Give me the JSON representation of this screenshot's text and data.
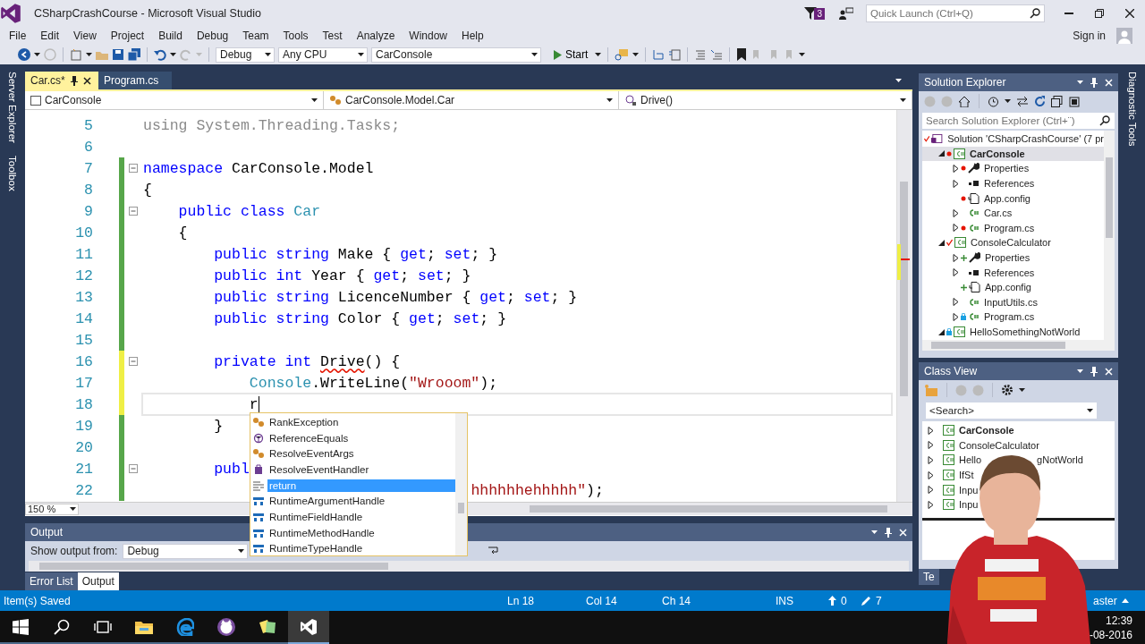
{
  "window": {
    "title": "CSharpCrashCourse - Microsoft Visual Studio",
    "notifications_badge": "3",
    "quick_launch": {
      "placeholder": "Quick Launch (Ctrl+Q)"
    }
  },
  "menu": [
    "File",
    "Edit",
    "View",
    "Project",
    "Build",
    "Debug",
    "Team",
    "Tools",
    "Test",
    "Analyze",
    "Window",
    "Help"
  ],
  "account": {
    "sign_in": "Sign in"
  },
  "toolbar": {
    "configuration": "Debug",
    "platform": "Any CPU",
    "startup_project": "CarConsole",
    "start": "Start"
  },
  "left_strip": [
    "Server Explorer",
    "Toolbox"
  ],
  "right_strip": [
    "Diagnostic Tools"
  ],
  "editor": {
    "tabs": [
      {
        "label": "Car.cs*",
        "selected": true
      },
      {
        "label": "Program.cs",
        "selected": false
      }
    ],
    "nav": [
      "CarConsole",
      "CarConsole.Model.Car",
      "Drive()"
    ],
    "zoom": "150 %",
    "lines": [
      {
        "number": "5",
        "fold": false,
        "current": false,
        "tokens": [
          {
            "kind": "faded",
            "text": "using System.Threading.Tasks;"
          }
        ]
      },
      {
        "number": "6",
        "fold": false,
        "current": false
      },
      {
        "number": "7",
        "color": "#57a64a",
        "fold": true,
        "current": false,
        "tokens": [
          {
            "kind": "kw",
            "text": "namespace"
          },
          {
            "kind": "plain",
            "text": " CarConsole.Model"
          }
        ]
      },
      {
        "number": "8",
        "color": "#57a64a",
        "fold": false,
        "current": false,
        "tokens": [
          {
            "kind": "plain",
            "text": "{"
          }
        ]
      },
      {
        "number": "9",
        "color": "#57a64a",
        "fold": true,
        "current": false,
        "tokens": [
          {
            "kind": "kw",
            "text": "    public"
          },
          {
            "kind": "kw",
            "text": " class"
          },
          {
            "kind": "type",
            "text": " Car"
          }
        ]
      },
      {
        "number": "10",
        "color": "#57a64a",
        "fold": false,
        "current": false,
        "tokens": [
          {
            "kind": "plain",
            "text": "    {"
          }
        ]
      },
      {
        "number": "11",
        "color": "#57a64a",
        "fold": false,
        "current": false,
        "tokens": [
          {
            "kind": "kw",
            "text": "        public"
          },
          {
            "kind": "kw",
            "text": " string"
          },
          {
            "kind": "plain",
            "text": " Make { "
          },
          {
            "kind": "kw",
            "text": "get"
          },
          {
            "kind": "plain",
            "text": "; "
          },
          {
            "kind": "kw",
            "text": "set"
          },
          {
            "kind": "plain",
            "text": "; }"
          }
        ]
      },
      {
        "number": "12",
        "color": "#57a64a",
        "fold": false,
        "current": false,
        "tokens": [
          {
            "kind": "kw",
            "text": "        public"
          },
          {
            "kind": "kw",
            "text": " int"
          },
          {
            "kind": "plain",
            "text": " Year { "
          },
          {
            "kind": "kw",
            "text": "get"
          },
          {
            "kind": "plain",
            "text": "; "
          },
          {
            "kind": "kw",
            "text": "set"
          },
          {
            "kind": "plain",
            "text": "; }"
          }
        ]
      },
      {
        "number": "13",
        "color": "#57a64a",
        "fold": false,
        "current": false,
        "tokens": [
          {
            "kind": "kw",
            "text": "        public"
          },
          {
            "kind": "kw",
            "text": " string"
          },
          {
            "kind": "plain",
            "text": " LicenceNumber { "
          },
          {
            "kind": "kw",
            "text": "get"
          },
          {
            "kind": "plain",
            "text": "; "
          },
          {
            "kind": "kw",
            "text": "set"
          },
          {
            "kind": "plain",
            "text": "; }"
          }
        ]
      },
      {
        "number": "14",
        "color": "#57a64a",
        "fold": false,
        "current": false,
        "tokens": [
          {
            "kind": "kw",
            "text": "        public"
          },
          {
            "kind": "kw",
            "text": " string"
          },
          {
            "kind": "plain",
            "text": " Color { "
          },
          {
            "kind": "kw",
            "text": "get"
          },
          {
            "kind": "plain",
            "text": "; "
          },
          {
            "kind": "kw",
            "text": "set"
          },
          {
            "kind": "plain",
            "text": "; }"
          }
        ]
      },
      {
        "number": "15",
        "color": "#57a64a",
        "fold": false,
        "current": false
      },
      {
        "number": "16",
        "color": "#efef45",
        "fold": true,
        "current": false,
        "tokens": [
          {
            "kind": "kw",
            "text": "        private"
          },
          {
            "kind": "kw",
            "text": " int "
          },
          {
            "kind": "error",
            "text": "Drive"
          },
          {
            "kind": "plain",
            "text": "() {"
          }
        ]
      },
      {
        "number": "17",
        "color": "#efef45",
        "fold": false,
        "current": false,
        "tokens": [
          {
            "kind": "type",
            "text": "            Console"
          },
          {
            "kind": "plain",
            "text": ".WriteLine("
          },
          {
            "kind": "str",
            "text": "\"Wrooom\""
          },
          {
            "kind": "plain",
            "text": ");"
          }
        ]
      },
      {
        "number": "18",
        "color": "#efef45",
        "fold": false,
        "current": true,
        "tokens": [
          {
            "kind": "plain",
            "text": "            r"
          }
        ]
      },
      {
        "number": "19",
        "color": "#57a64a",
        "fold": false,
        "current": false,
        "tokens": [
          {
            "kind": "plain",
            "text": "        }"
          }
        ]
      },
      {
        "number": "20",
        "color": "#57a64a",
        "fold": false,
        "current": false
      },
      {
        "number": "21",
        "color": "#57a64a",
        "fold": true,
        "current": false,
        "tokens": [
          {
            "kind": "kw",
            "text": "        publ"
          }
        ]
      },
      {
        "number": "22",
        "color": "#57a64a",
        "fold": false,
        "current": false,
        "tokens": [
          {
            "kind": "str",
            "text": "                                     hhhhhhehhhhh\""
          },
          {
            "kind": "plain",
            "text": ");"
          }
        ]
      }
    ]
  },
  "completion": {
    "items": [
      {
        "label": "RankException",
        "kind": "class",
        "selected": false
      },
      {
        "label": "ReferenceEquals",
        "kind": "method",
        "selected": false
      },
      {
        "label": "ResolveEventArgs",
        "kind": "class",
        "selected": false
      },
      {
        "label": "ResolveEventHandler",
        "kind": "delegate",
        "selected": false
      },
      {
        "label": "return",
        "kind": "keyword",
        "selected": true
      },
      {
        "label": "RuntimeArgumentHandle",
        "kind": "struct",
        "selected": false
      },
      {
        "label": "RuntimeFieldHandle",
        "kind": "struct",
        "selected": false
      },
      {
        "label": "RuntimeMethodHandle",
        "kind": "struct",
        "selected": false
      },
      {
        "label": "RuntimeTypeHandle",
        "kind": "struct",
        "selected": false
      }
    ]
  },
  "output": {
    "title": "Output",
    "source_label": "Show output from:",
    "source": "Debug",
    "tabs": [
      {
        "label": "Error List",
        "selected": false
      },
      {
        "label": "Output",
        "selected": true
      }
    ]
  },
  "solution_explorer": {
    "title": "Solution Explorer",
    "search": {
      "placeholder": "Search Solution Explorer (Ctrl+¨)"
    },
    "tree": [
      {
        "label": "Solution 'CSharpCrashCourse' (7 pr",
        "kind": "solution",
        "git": {
          "kind": "checked"
        },
        "selected": false,
        "bold": false,
        "children": [
          {
            "label": "CarConsole",
            "kind": "project",
            "git": {
              "kind": "modified"
            },
            "expanded": true,
            "selected": true,
            "bold": true,
            "children": [
              {
                "label": "Properties",
                "kind": "wrench",
                "git": {
                  "kind": "modified"
                },
                "expanded": false,
                "selected": false,
                "bold": false
              },
              {
                "label": "References",
                "kind": "references",
                "git": {
                  "kind": "none"
                },
                "expanded": false,
                "selected": false,
                "bold": false
              },
              {
                "label": "App.config",
                "kind": "config",
                "git": {
                  "kind": "modified"
                },
                "selected": false,
                "bold": false
              },
              {
                "label": "Car.cs",
                "kind": "csharp",
                "git": {
                  "kind": "none"
                },
                "expanded": false,
                "selected": false,
                "bold": false
              },
              {
                "label": "Program.cs",
                "kind": "csharp",
                "git": {
                  "kind": "modified"
                },
                "expanded": false,
                "selected": false,
                "bold": false
              }
            ]
          },
          {
            "label": "ConsoleCalculator",
            "kind": "project",
            "git": {
              "kind": "checked"
            },
            "expanded": true,
            "selected": false,
            "bold": false,
            "children": [
              {
                "label": "Properties",
                "kind": "wrench",
                "git": {
                  "kind": "added"
                },
                "expanded": false,
                "selected": false,
                "bold": false
              },
              {
                "label": "References",
                "kind": "references",
                "git": {
                  "kind": "none"
                },
                "expanded": false,
                "selected": false,
                "bold": false
              },
              {
                "label": "App.config",
                "kind": "config",
                "git": {
                  "kind": "added"
                },
                "selected": false,
                "bold": false
              },
              {
                "label": "InputUtils.cs",
                "kind": "csharp",
                "git": {
                  "kind": "none"
                },
                "expanded": false,
                "selected": false,
                "bold": false
              },
              {
                "label": "Program.cs",
                "kind": "csharp",
                "git": {
                  "kind": "locked"
                },
                "expanded": false,
                "selected": false,
                "bold": false
              }
            ]
          },
          {
            "label": "HelloSomethingNotWorld",
            "kind": "project",
            "git": {
              "kind": "locked"
            },
            "expanded": true,
            "selected": false,
            "bold": false
          }
        ]
      }
    ]
  },
  "class_view": {
    "title": "Class View",
    "search": "<Search>",
    "items": [
      {
        "label": "CarConsole",
        "bold": true
      },
      {
        "label": "ConsoleCalculator",
        "bold": false
      },
      {
        "label": "Hello",
        "label_end": "gNotWorld",
        "bold": false
      },
      {
        "label": "IfSt",
        "bold": false
      },
      {
        "label": "Inpu",
        "bold": false
      },
      {
        "label": "Inpu",
        "bold": false
      }
    ]
  },
  "bottom_tab": "Te",
  "status_bar": {
    "message": "Item(s) Saved",
    "items": [
      {
        "kind": "text",
        "text": "Ln 18"
      },
      {
        "kind": "text",
        "text": "Col 14"
      },
      {
        "kind": "text",
        "text": "Ch 14"
      },
      {
        "kind": "text",
        "text": "INS"
      },
      {
        "kind": "push",
        "text": "0"
      },
      {
        "kind": "pencil",
        "text": "7"
      },
      {
        "kind": "branch",
        "text": "aster"
      }
    ]
  },
  "taskbar": {
    "apps": [
      {
        "kind": "windows",
        "active": false
      },
      {
        "kind": "search",
        "active": false
      },
      {
        "kind": "taskview",
        "active": false
      },
      {
        "kind": "folder",
        "active": false
      },
      {
        "kind": "edge",
        "active": false
      },
      {
        "kind": "github",
        "active": false
      },
      {
        "kind": "notes",
        "active": false
      },
      {
        "kind": "vs",
        "active": true
      }
    ],
    "clock": [
      "12:39",
      "-08-2016"
    ]
  }
}
